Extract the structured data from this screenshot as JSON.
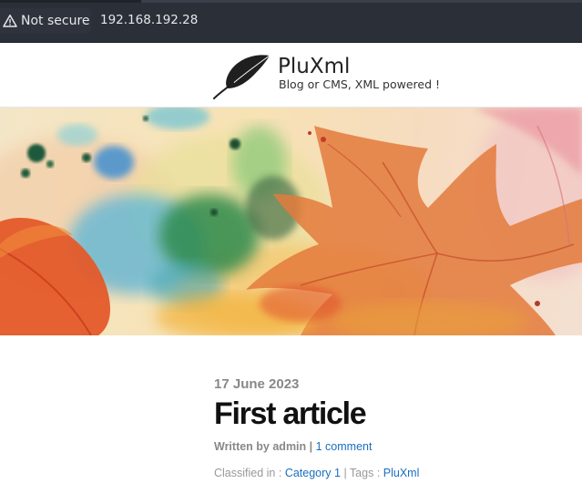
{
  "browser": {
    "security_label": "Not secure",
    "url": "192.168.192.28"
  },
  "site": {
    "title": "PluXml",
    "description": "Blog or CMS, XML powered !"
  },
  "article": {
    "date": "17 June 2023",
    "title": "First article",
    "written_by": "Written by admin",
    "separator": " | ",
    "comments_link": "1 comment",
    "classified_label": "Classified in : ",
    "category_link": "Category 1",
    "tags_label": " | Tags : ",
    "tag_link": "PluXml"
  },
  "colors": {
    "link": "#1a6fbf",
    "muted": "#888888",
    "title": "#111111"
  }
}
